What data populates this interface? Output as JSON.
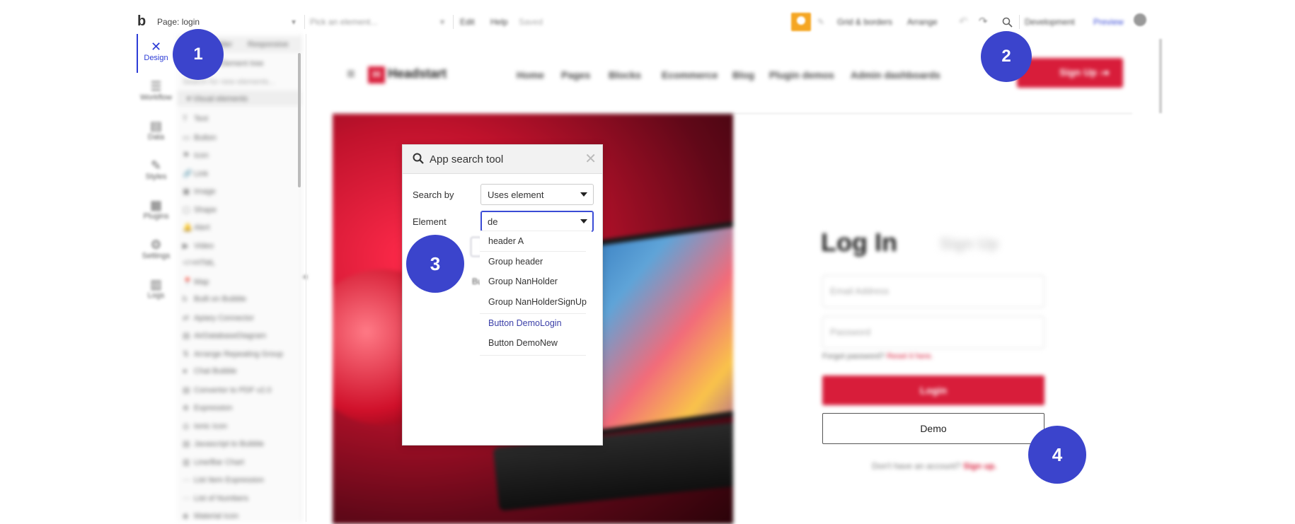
{
  "editor": {
    "topbar": {
      "logo": "b",
      "page_label": "Page: login",
      "element_picker_placeholder": "Pick an element...",
      "menu_edit": "Edit",
      "menu_help": "Help",
      "saved_status": "Saved",
      "grid_borders": "Grid & borders",
      "arrange": "Arrange",
      "env": "Development",
      "preview": "Preview"
    },
    "rail": {
      "items": [
        {
          "label": "Design",
          "icon": "design-icon"
        },
        {
          "label": "Workflow",
          "icon": "workflow-icon"
        },
        {
          "label": "Data",
          "icon": "data-icon"
        },
        {
          "label": "Styles",
          "icon": "styles-icon"
        },
        {
          "label": "Plugins",
          "icon": "plugins-icon"
        },
        {
          "label": "Settings",
          "icon": "settings-icon"
        },
        {
          "label": "Logs",
          "icon": "logs-icon"
        }
      ]
    },
    "palette": {
      "tabs": [
        "UI Builder",
        "Responsive"
      ],
      "element_tree": "Element tree",
      "search_placeholder": "Search for new elements...",
      "section": "Visual elements",
      "elements": [
        "Text",
        "Button",
        "Icon",
        "Link",
        "Image",
        "Shape",
        "Alert",
        "Video",
        "HTML",
        "Map",
        "Built on Bubble",
        "Apiary Connector",
        "AirDatabaseDiagram",
        "Arrange Repeating Group",
        "Chat Bubble",
        "Convertor to PDF v2.0",
        "Expression",
        "Ionic Icon",
        "Javascript to Bubble",
        "Line/Bar Chart",
        "List Item Expression",
        "List of Numbers",
        "Material Icon"
      ]
    }
  },
  "preview_page": {
    "brand": "Headstart",
    "nav_links": [
      "Home",
      "Pages",
      "Blocks",
      "Ecommerce",
      "Blog",
      "Plugin demos",
      "Admin dashboards"
    ],
    "signup_button": "Sign Up",
    "login_title": "Log In",
    "signup_tab": "Sign Up",
    "email_placeholder": "Email Address",
    "password_placeholder": "Password",
    "forgot_text": "Forgot password?",
    "reset_link": "Reset it here.",
    "login_button": "Login",
    "demo_button": "Demo",
    "no_account_text": "Don't have an account?",
    "signup_link": "Sign up."
  },
  "search_tool": {
    "title": "App search tool",
    "search_by_label": "Search by",
    "search_by_value": "Uses element",
    "element_label": "Element",
    "element_value": "de",
    "results": [
      "header A",
      "Group header",
      "Group NanHolder",
      "Group NanHolderSignUp",
      "Button DemoLogin",
      "Button DemoNew"
    ],
    "hidden_partial": "Bu"
  },
  "markers": [
    "1",
    "2",
    "3",
    "4"
  ],
  "colors": {
    "accent_blue": "#3b44cc",
    "brand_red": "#d81d3a",
    "highlight_link": "#3b3fa8"
  }
}
